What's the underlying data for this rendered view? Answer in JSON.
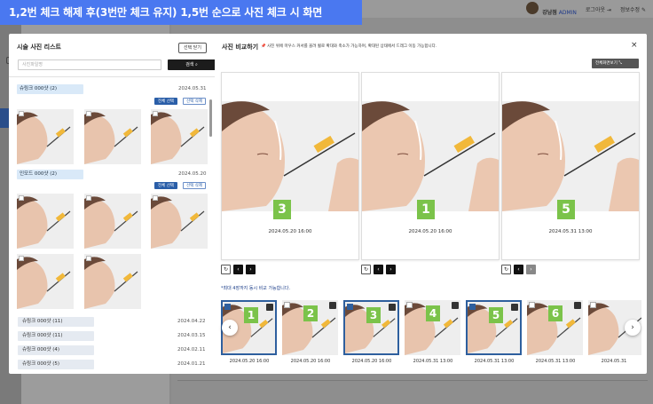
{
  "banner": {
    "text": "1,2번 체크 해제 후(3번만 체크 유지)  1,5번 순으로 사진 체크 시  화면"
  },
  "bg_header": {
    "user_name": "강남점",
    "role": "ADMIN",
    "logout": "로그아웃",
    "profile": "정보수정"
  },
  "left_panel": {
    "title": "시술 사진 리스트",
    "close_select": "선택 닫기",
    "search_placeholder": "사진파일명",
    "search_button": "검색",
    "groups": [
      {
        "label": "슈링크 000샷 (2)",
        "date": "2024.05.31",
        "select_all": "전체 선택",
        "delete_selected": "선택 삭제"
      },
      {
        "label": "인모드 000샷 (2)",
        "date": "2024.05.20",
        "select_all": "전체 선택",
        "delete_selected": "선택 삭제"
      }
    ],
    "list": [
      {
        "label": "슈링크 000샷 (11)",
        "date": "2024.04.22"
      },
      {
        "label": "슈링크 000샷 (11)",
        "date": "2024.03.15"
      },
      {
        "label": "슈링크 000샷 (4)",
        "date": "2024.02.11"
      },
      {
        "label": "슈링크 000샷 (5)",
        "date": "2024.01.21"
      }
    ]
  },
  "right_panel": {
    "title": "사진 비교하기",
    "note": "사진 위에 마우스 커서를 올려 휠로 확대와 축소가 가능하며, 확대된 상태에서 드래그 이동 가능합니다.",
    "fullscreen": "전체화면보기",
    "cards": [
      {
        "number": "3",
        "date": "2024.05.20 16:00"
      },
      {
        "number": "1",
        "date": "2024.05.20 16:00"
      },
      {
        "number": "5",
        "date": "2024.05.31 13:00"
      }
    ],
    "max_note": "*최대 4장까지 동시 비교 가능합니다.",
    "strip": [
      {
        "number": "1",
        "date": "2024.05.20 16:00",
        "selected": true
      },
      {
        "number": "2",
        "date": "2024.05.20 16:00",
        "selected": false
      },
      {
        "number": "3",
        "date": "2024.05.20 16:00",
        "selected": true
      },
      {
        "number": "4",
        "date": "2024.05.31 13:00",
        "selected": false
      },
      {
        "number": "5",
        "date": "2024.05.31 13:00",
        "selected": true
      },
      {
        "number": "6",
        "date": "2024.05.31 13:00",
        "selected": false
      },
      {
        "number": "",
        "date": "2024.05.31",
        "selected": false
      }
    ]
  },
  "colors": {
    "banner": "#4a78f0",
    "badge": "#7bc34a",
    "selected_border": "#2e5f9e"
  }
}
